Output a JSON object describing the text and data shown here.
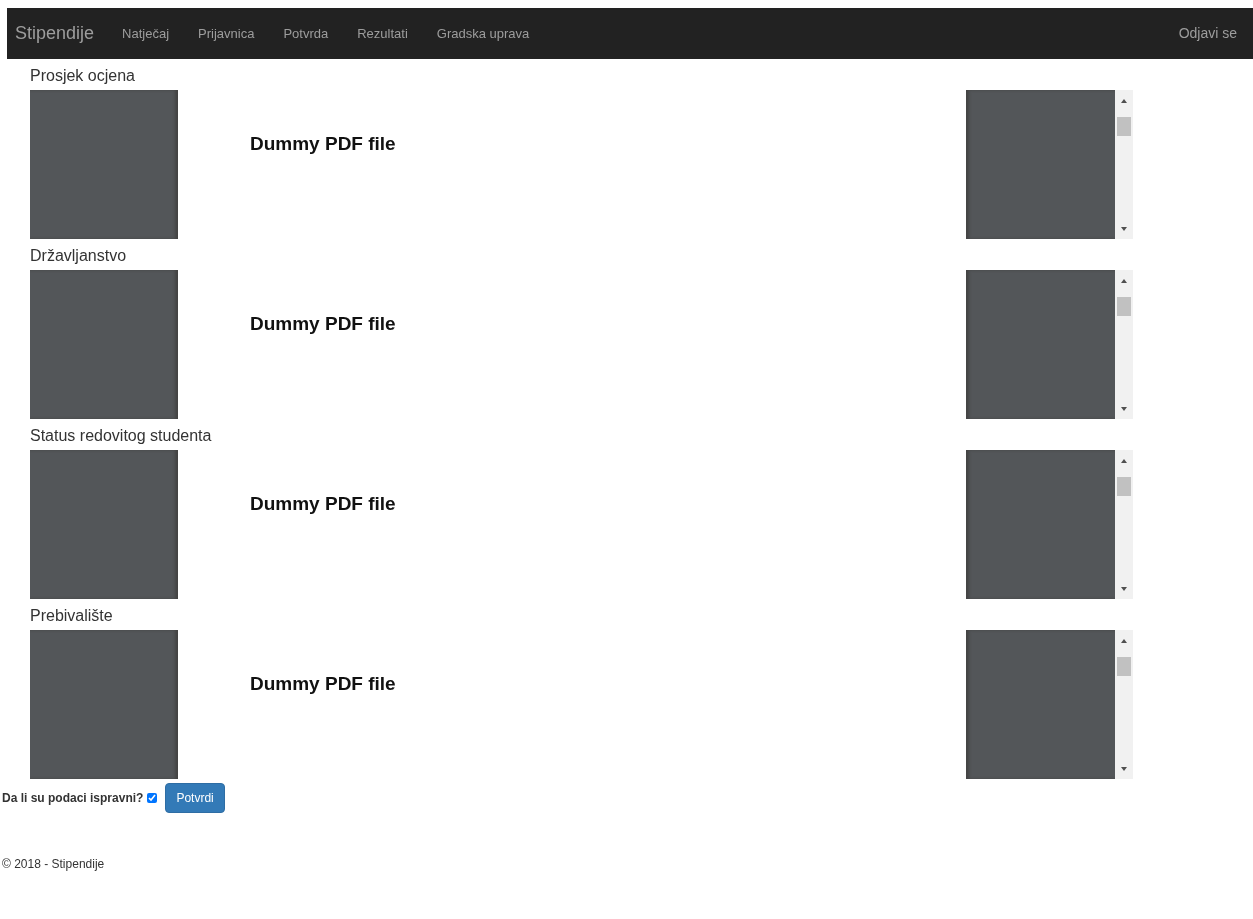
{
  "navbar": {
    "brand": "Stipendije",
    "links": [
      "Natječaj",
      "Prijavnica",
      "Potvrda",
      "Rezultati",
      "Gradska uprava"
    ],
    "logout": "Odjavi se"
  },
  "documents": [
    {
      "title": "Prosjek ocjena",
      "pdf_text": "Dummy PDF file"
    },
    {
      "title": "Državljanstvo",
      "pdf_text": "Dummy PDF file"
    },
    {
      "title": "Status redovitog studenta",
      "pdf_text": "Dummy PDF file"
    },
    {
      "title": "Prebivalište",
      "pdf_text": "Dummy PDF file"
    }
  ],
  "confirm": {
    "label": "Da li su podaci ispravni?",
    "checked": true,
    "button": "Potvrdi"
  },
  "footer": "© 2018 - Stipendije"
}
